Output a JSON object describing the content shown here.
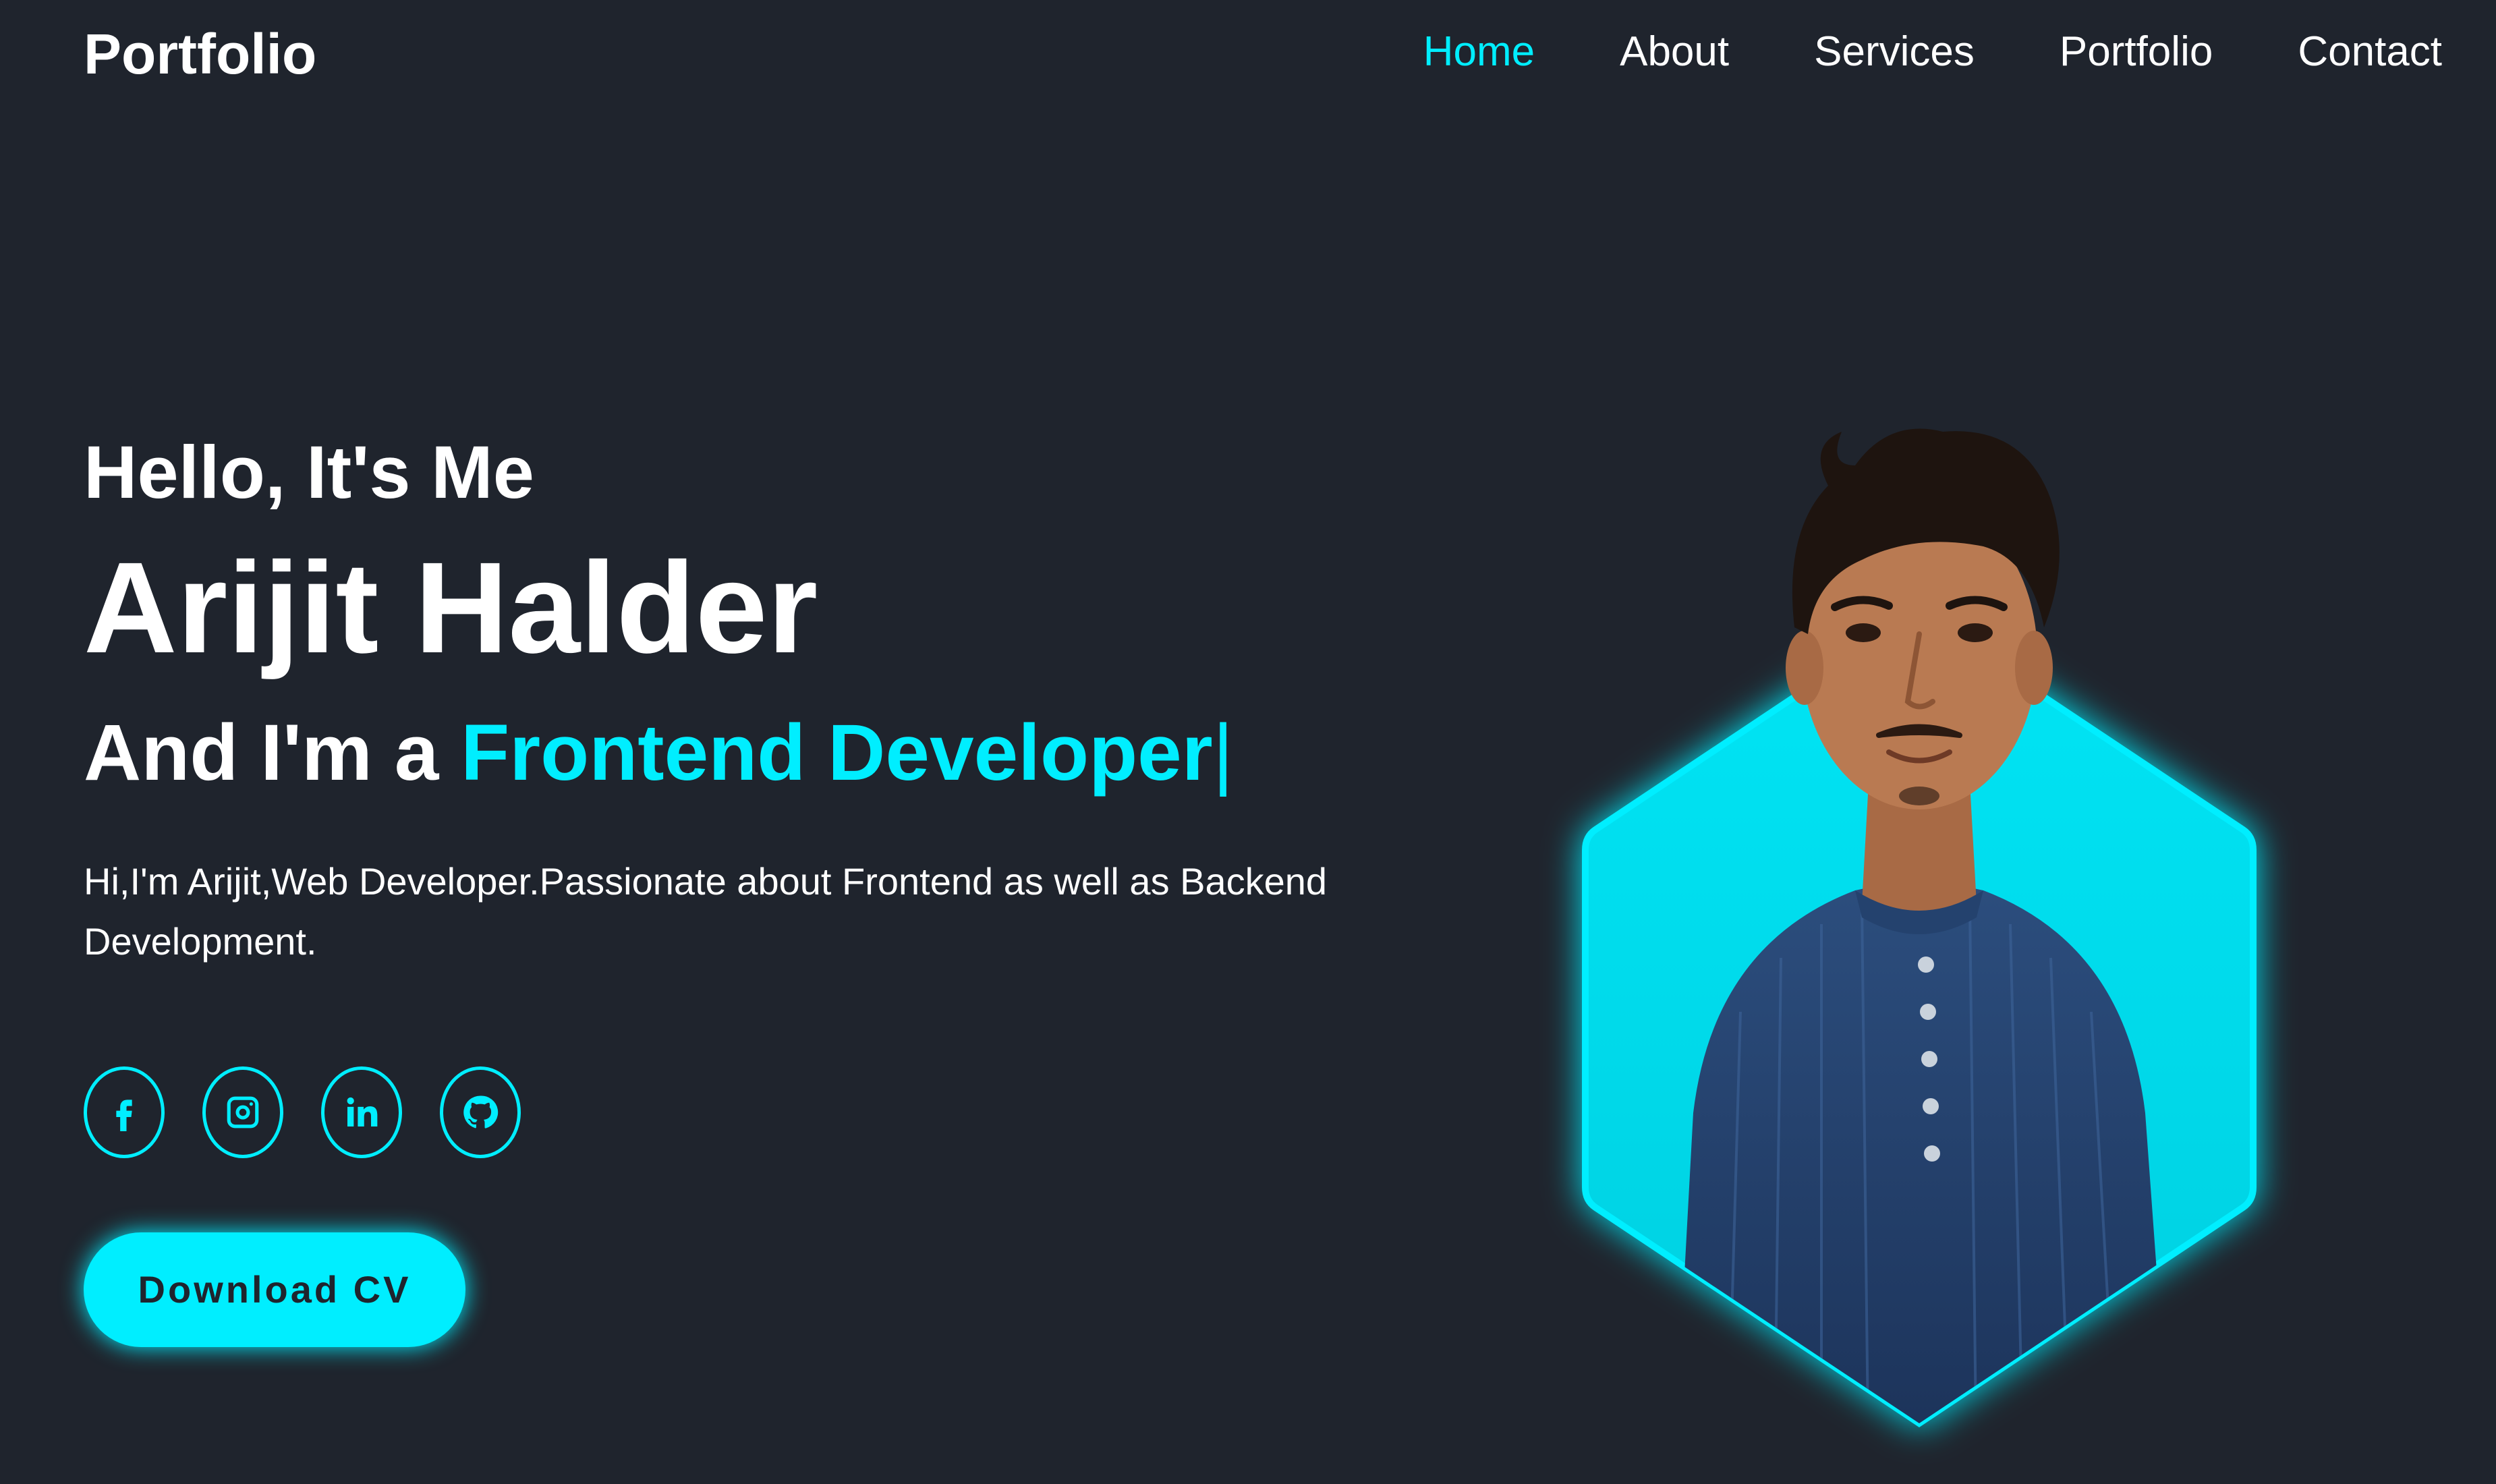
{
  "header": {
    "logo": "Portfolio",
    "nav": [
      "Home",
      "About",
      "Services",
      "Portfolio",
      "Contact"
    ],
    "active_nav": "Home"
  },
  "hero": {
    "greeting": "Hello, It's Me",
    "name": "Arijit Halder",
    "role_prefix": "And I'm a ",
    "role_highlight": "Frontend Developer",
    "role_cursor": "|",
    "bio": "Hi,I'm Arijit,Web Developer.Passionate about Frontend as well as Backend Development.",
    "cta_label": "Download CV"
  },
  "socials": [
    {
      "icon": "facebook-icon"
    },
    {
      "icon": "instagram-icon"
    },
    {
      "icon": "linkedin-icon"
    },
    {
      "icon": "github-icon"
    }
  ],
  "colors": {
    "background": "#1f242d",
    "accent": "#00eeff",
    "text": "#ffffff"
  }
}
